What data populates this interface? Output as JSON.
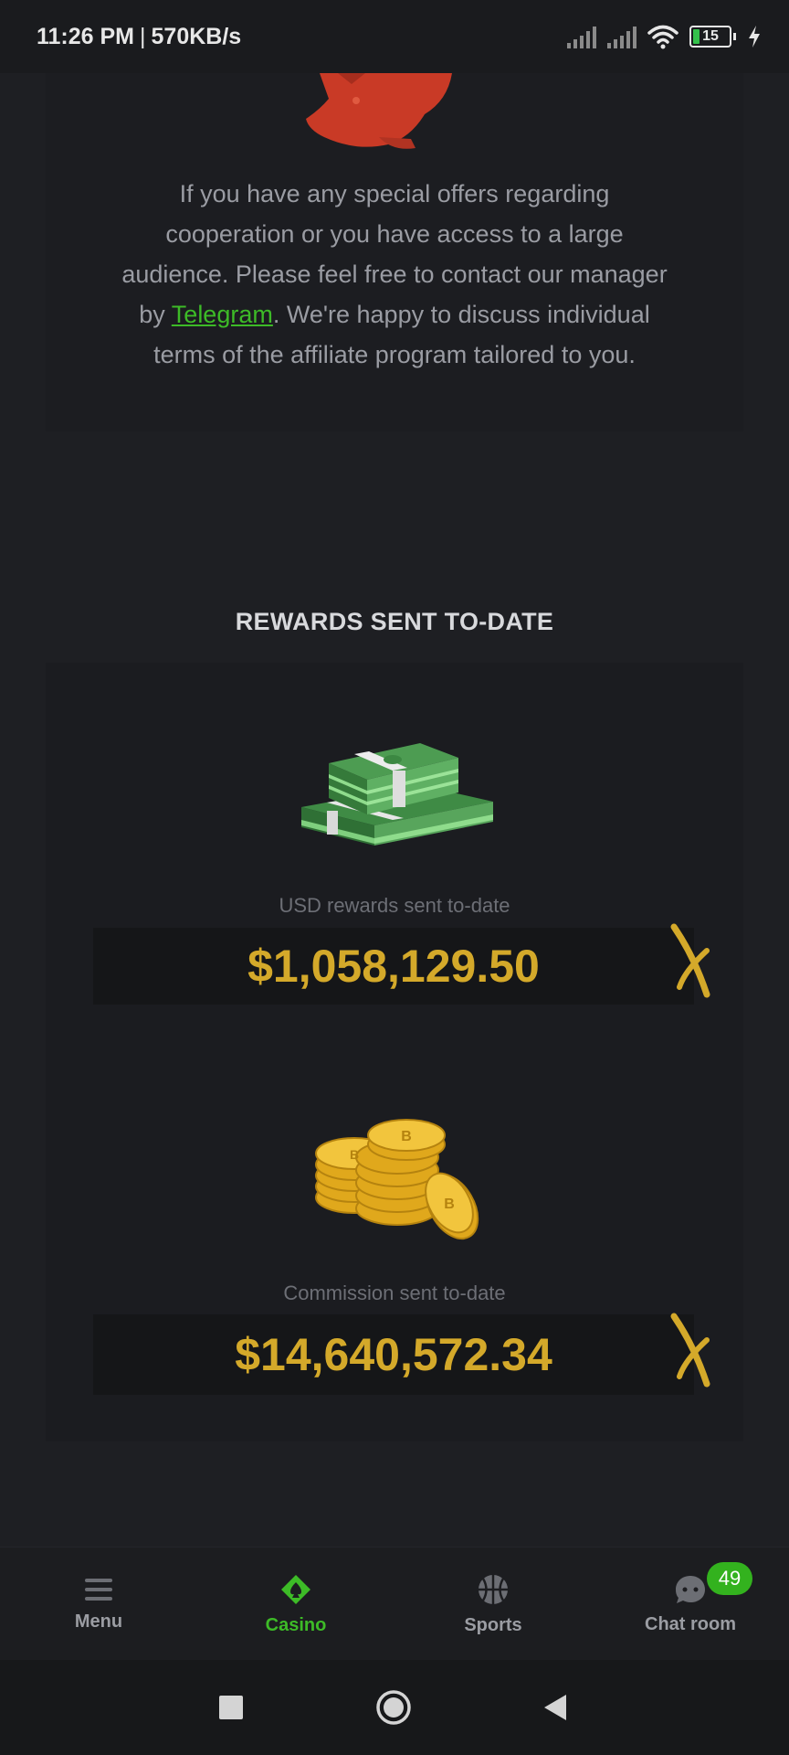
{
  "status_bar": {
    "time": "11:26 PM",
    "separator": "|",
    "speed": "570KB/s",
    "battery": "15"
  },
  "offer": {
    "line1": "If you have any special offers regarding",
    "line2": "cooperation or you have access to a large",
    "line3": "audience. Please feel free to contact our manager",
    "line4_prefix": "by ",
    "telegram_link": "Telegram",
    "line4_suffix": ". We're happy to discuss individual",
    "line5": "terms of the affiliate program tailored to you."
  },
  "rewards": {
    "title": "REWARDS SENT TO-DATE",
    "usd": {
      "caption": "USD rewards sent to-date",
      "value": "$1,058,129.50"
    },
    "commission": {
      "caption": "Commission sent to-date",
      "value": "$14,640,572.34"
    }
  },
  "bottom_nav": {
    "items": [
      {
        "label": "Menu",
        "icon": "menu-icon"
      },
      {
        "label": "Casino",
        "icon": "casino-icon",
        "active": true
      },
      {
        "label": "Sports",
        "icon": "basketball-icon"
      },
      {
        "label": "Chat room",
        "icon": "chat-icon",
        "badge": "49"
      }
    ]
  },
  "colors": {
    "accent_green": "#3dbb27",
    "gold": "#d4a92a",
    "background": "#1e1f23"
  }
}
